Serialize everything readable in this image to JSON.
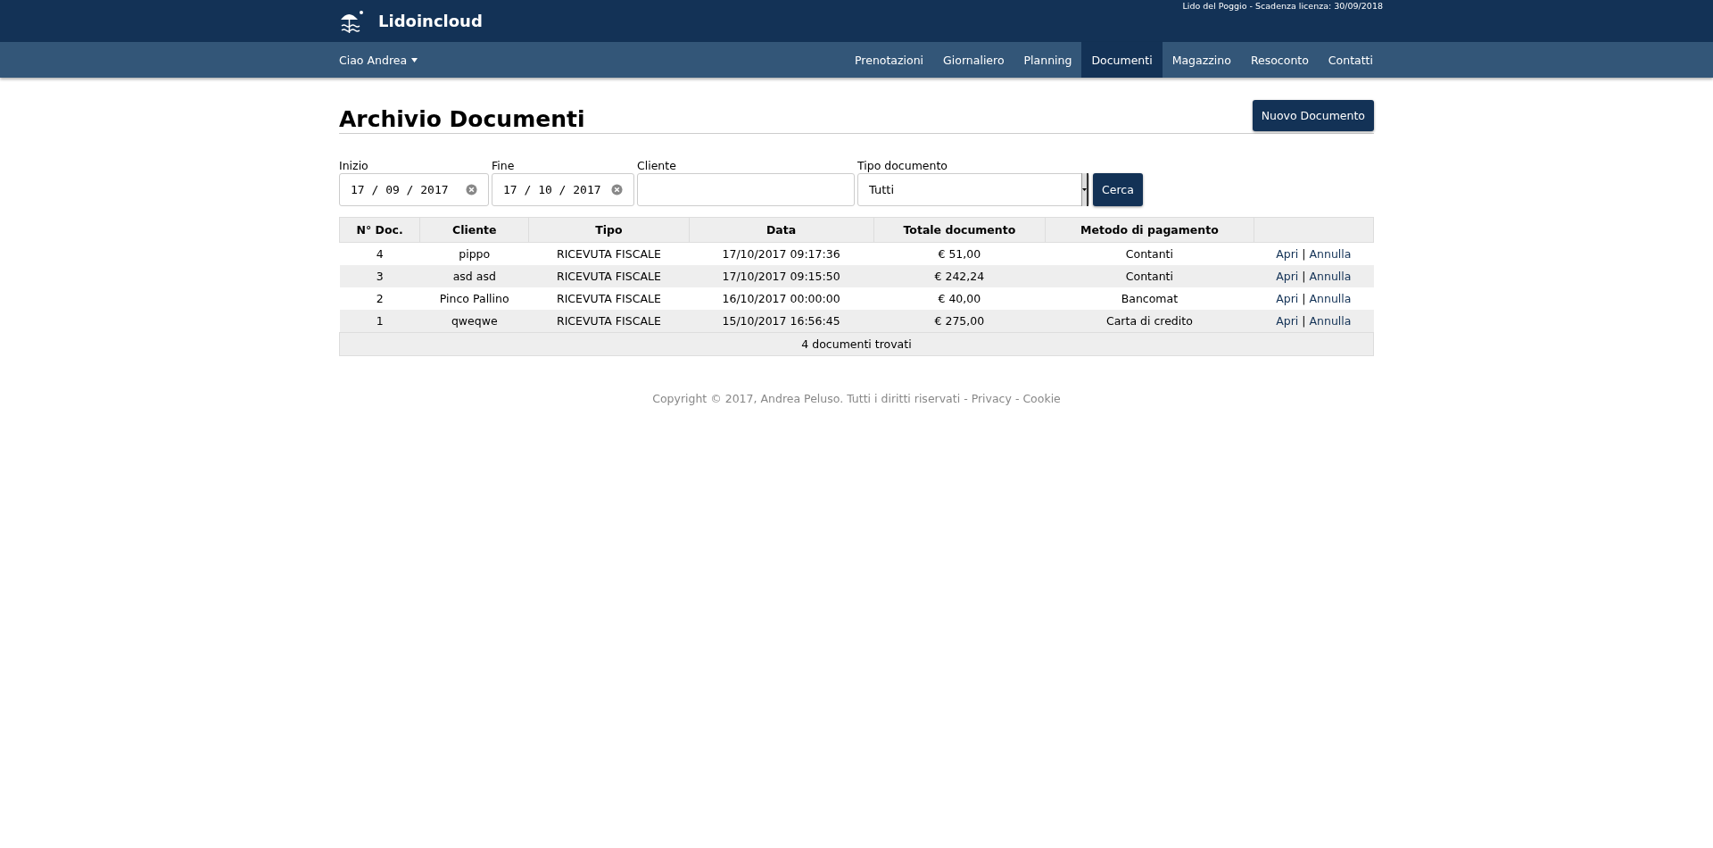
{
  "header": {
    "brand": "Lidoincloud",
    "license": "Lido del Poggio - Scadenza licenza: 30/09/2018"
  },
  "nav": {
    "user": "Ciao Andrea",
    "items": [
      {
        "label": "Prenotazioni",
        "selected": false
      },
      {
        "label": "Giornaliero",
        "selected": false
      },
      {
        "label": "Planning",
        "selected": false
      },
      {
        "label": "Documenti",
        "selected": true
      },
      {
        "label": "Magazzino",
        "selected": false
      },
      {
        "label": "Resoconto",
        "selected": false
      },
      {
        "label": "Contatti",
        "selected": false
      }
    ]
  },
  "page": {
    "title": "Archivio Documenti",
    "new_button": "Nuovo Documento"
  },
  "filters": {
    "start": {
      "label": "Inizio",
      "value": "17 / 09 / 2017"
    },
    "end": {
      "label": "Fine",
      "value": "17 / 10 / 2017"
    },
    "client": {
      "label": "Cliente"
    },
    "doc_type": {
      "label": "Tipo documento",
      "value": "Tutti"
    },
    "search_button": "Cerca"
  },
  "table": {
    "columns": [
      "N° Doc.",
      "Cliente",
      "Tipo",
      "Data",
      "Totale documento",
      "Metodo di pagamento"
    ],
    "rows": [
      {
        "cells": [
          "4",
          "pippo",
          "RICEVUTA FISCALE",
          "17/10/2017 09:17:36",
          "€ 51,00",
          "Contanti"
        ],
        "actions": [
          "Apri",
          "Annulla"
        ]
      },
      {
        "cells": [
          "3",
          "asd asd",
          "RICEVUTA FISCALE",
          "17/10/2017 09:15:50",
          "€ 242,24",
          "Contanti"
        ],
        "actions": [
          "Apri",
          "Annulla"
        ]
      },
      {
        "cells": [
          "2",
          "Pinco Pallino",
          "RICEVUTA FISCALE",
          "16/10/2017 00:00:00",
          "€ 40,00",
          "Bancomat"
        ],
        "actions": [
          "Apri",
          "Annulla"
        ]
      },
      {
        "cells": [
          "1",
          "qweqwe",
          "RICEVUTA FISCALE",
          "15/10/2017 16:56:45",
          "€ 275,00",
          "Carta di credito"
        ],
        "actions": [
          "Apri",
          "Annulla"
        ]
      }
    ],
    "action_separator": "|",
    "summary": "4 documenti trovati"
  },
  "footer": {
    "copyright": "Copyright © 2017, Andrea Peluso. Tutti i diritti riservati",
    "separator": "-",
    "links": [
      "Privacy",
      "Cookie"
    ]
  }
}
